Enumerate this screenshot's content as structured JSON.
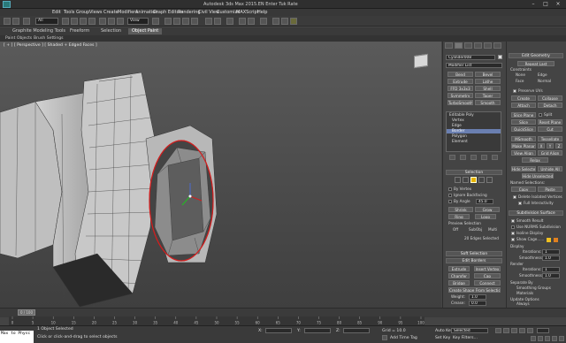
{
  "window": {
    "title": "Autodesk 3ds Max 2015.EN   Enter Tuk Rate",
    "controls": [
      "–",
      "□",
      "×"
    ]
  },
  "menubar": {
    "items": [
      "Edit",
      "Tools",
      "Group",
      "Views",
      "Create",
      "Modifiers",
      "Animation",
      "Graph Editors",
      "Rendering",
      "Civil View",
      "Customize",
      "MAXScript",
      "Help"
    ]
  },
  "toolbar": {
    "selection_filter": "All",
    "ref_coord": "View"
  },
  "ribbon": {
    "tabs": [
      "Graphite Modeling Tools",
      "Freeform",
      "Selection",
      "Object Paint"
    ],
    "active": "Object Paint",
    "subtabs": [
      "Paint Objects",
      "Brush Settings"
    ]
  },
  "viewport": {
    "label": "[ + ] [ Perspective ] [ Shaded + Edged Faces ]"
  },
  "command_panel": {
    "object_name": "Cylinder008",
    "modifier_list": "Modifier List",
    "modifier_buttons": [
      [
        "Bend",
        "Bevel"
      ],
      [
        "Extrude",
        "Lathe"
      ],
      [
        "FFD 3x3x3",
        "Shell"
      ],
      [
        "Symmetry",
        "Taper"
      ],
      [
        "TurboSmooth",
        "Smooth"
      ]
    ],
    "stack": [
      "Editable Poly",
      "Vertex",
      "Edge",
      "Border",
      "Polygon",
      "Element"
    ],
    "stack_selected": "Border",
    "selection_title": "Selection",
    "by_vertex": "By Vertex",
    "ignore_backfacing": "Ignore Backfacing",
    "by_angle": "By Angle",
    "by_angle_value": "45.0",
    "shrink": "Shrink",
    "grow": "Grow",
    "ring": "Ring",
    "loop": "Loop",
    "preview_selection": "Preview Selection",
    "preview_opts": [
      "Off",
      "SubObj",
      "Multi"
    ],
    "selected_count": "20 Edges Selected",
    "soft_selection": "Soft Selection",
    "edit_borders": "Edit Borders",
    "extrude": "Extrude",
    "insert_vertex": "Insert Vertex",
    "chamfer": "Chamfer",
    "cap": "Cap",
    "bridge": "Bridge",
    "connect": "Connect",
    "create_shape": "Create Shape From Selection",
    "weight_label": "Weight:",
    "weight_value": "1.0",
    "crease_label": "Crease:",
    "crease_value": "0.0",
    "edit_tri": "Edit Tri.",
    "turn": "Turn"
  },
  "panel2": {
    "edit_geometry": "Edit Geometry",
    "repeat_last": "Repeat Last",
    "constraints": "Constraints",
    "none": "None",
    "edge": "Edge",
    "face": "Face",
    "normal": "Normal",
    "preserve_uvs": "Preserve UVs",
    "create": "Create",
    "collapse": "Collapse",
    "attach": "Attach",
    "detach": "Detach",
    "slice_plane": "Slice Plane",
    "split": "Split",
    "slice": "Slice",
    "reset_plane": "Reset Plane",
    "quickslice": "QuickSlice",
    "cut": "Cut",
    "msmooth": "MSmooth",
    "tessellate": "Tessellate",
    "make_planar": "Make Planar",
    "x": "X",
    "y": "Y",
    "z": "Z",
    "view_align": "View Align",
    "grid_align": "Grid Align",
    "relax": "Relax",
    "hide_selected": "Hide Selected",
    "unhide_all": "Unhide All",
    "hide_unselected": "Hide Unselected",
    "named_selections": "Named Selections:",
    "copy": "Copy",
    "paste": "Paste",
    "delete_isolated": "Delete Isolated Vertices",
    "full_interactivity": "Full Interactivity",
    "subdivision_surface": "Subdivision Surface",
    "smooth_result": "Smooth Result",
    "use_nurms": "Use NURMS Subdivision",
    "isoline": "Isoline Display",
    "show_cage": "Show Cage......",
    "display": "Display",
    "iterations": "Iterations:",
    "iterations_value": "1",
    "smoothness": "Smoothness:",
    "smoothness_value": "1.0",
    "render": "Render",
    "separate_by": "Separate By",
    "smoothing_groups": "Smoothing Groups",
    "materials": "Materials",
    "update_options": "Update Options",
    "always": "Always",
    "when_rendering": "When Rendering",
    "manually": "Manually"
  },
  "timeline": {
    "frame": "0 / 100",
    "ticks": [
      "0",
      "5",
      "10",
      "15",
      "20",
      "25",
      "30",
      "35",
      "40",
      "45",
      "50",
      "55",
      "60",
      "65",
      "70",
      "75",
      "80",
      "85",
      "90",
      "95",
      "100"
    ]
  },
  "status": {
    "maxscript": "Max to Physc",
    "objects_selected": "1 Object Selected",
    "prompt": "Click or click-and-drag to select objects",
    "x_label": "X:",
    "y_label": "Y:",
    "z_label": "Z:",
    "grid": "Grid = 10.0",
    "add_time_tag": "Add Time Tag",
    "auto_key": "Auto Key",
    "selected": "Selected",
    "set_key": "Set Key",
    "key_filters": "Key Filters..."
  },
  "colors": {
    "viewport_bg": "#4d4d4d",
    "selection_red": "#d21e1e",
    "stack_selected": "#6a7fb0",
    "show_cage_a": "#f0c020",
    "show_cage_b": "#e08020"
  }
}
